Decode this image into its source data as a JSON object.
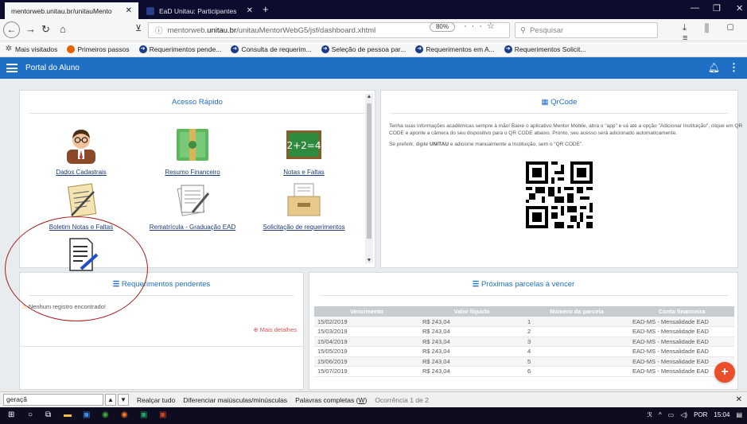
{
  "browser": {
    "tabs": [
      {
        "label": "mentorweb.unitau.br/unitauMento",
        "active": true
      },
      {
        "label": "EaD Unitau: Participantes",
        "active": false
      }
    ],
    "url_prefix": "mentorweb.",
    "url_domain": "unitau.br",
    "url_path": "/unitauMentorWebG5/jsf/dashboard.xhtml",
    "zoom": "80%",
    "search_placeholder": "Pesquisar",
    "bookmarks": [
      {
        "label": "Mais visitados",
        "icon": "gear-icon"
      },
      {
        "label": "Primeiros passos",
        "icon": "firefox-icon"
      },
      {
        "label": "Requerimentos pende...",
        "icon": "link-icon"
      },
      {
        "label": "Consulta de requerim...",
        "icon": "link-icon"
      },
      {
        "label": "Seleção de pessoa par...",
        "icon": "link-icon"
      },
      {
        "label": "Requerimentos em A...",
        "icon": "link-icon"
      },
      {
        "label": "Requerimentos Solicit...",
        "icon": "link-icon"
      }
    ]
  },
  "app": {
    "title": "Portal do Aluno",
    "accent": "#1f6fc5"
  },
  "acesso_rapido": {
    "title": "Acesso Rápido",
    "tiles": [
      {
        "label": "Dados Cadastrais",
        "icon": "user-avatar-icon"
      },
      {
        "label": "Resumo Financeiro",
        "icon": "money-icon"
      },
      {
        "label": "Notas e Faltas",
        "icon": "chalkboard-icon"
      },
      {
        "label": "Boletim Notas e Faltas",
        "icon": "report-card-icon"
      },
      {
        "label": "Rematrícula - Graduação EAD",
        "icon": "document-pen-icon"
      },
      {
        "label": "Solicitação de requerimentos",
        "icon": "file-cabinet-icon"
      },
      {
        "label": "",
        "icon": "edit-document-icon"
      }
    ]
  },
  "qrcode": {
    "title": "QrCode",
    "text1": "Tenha suas informações acadêmicas sempre à mão! Baixe o aplicativo Mentor Mobile, abra o \"app\" e vá até a opção \"Adicionar Instituição\", clique em QR CODE e aponte a câmera do seu dispositivo para o QR CODE abaixo. Pronto, seu acesso será adicionado automaticamente.",
    "text2_prefix": "Se preferir, digite ",
    "text2_strong": "UNITAU",
    "text2_suffix": " e adicione manualmente a Instituição, sem o \"QR CODE\"."
  },
  "requerimentos": {
    "title": "Requerimentos pendentes",
    "empty": "Nenhum registro encontrado!",
    "more": "Mais detalhes"
  },
  "parcelas": {
    "title": "Próximas parcelas à vencer",
    "columns": [
      "Vencimento",
      "Valor líquido",
      "Número da parcela",
      "Conta financeira"
    ],
    "rows": [
      [
        "15/02/2019",
        "R$ 243,04",
        "1",
        "EAD-MS - Mensalidade EAD"
      ],
      [
        "15/03/2019",
        "R$ 243,04",
        "2",
        "EAD-MS - Mensalidade EAD"
      ],
      [
        "15/04/2019",
        "R$ 243,04",
        "3",
        "EAD-MS - Mensalidade EAD"
      ],
      [
        "15/05/2019",
        "R$ 243,04",
        "4",
        "EAD-MS - Mensalidade EAD"
      ],
      [
        "15/06/2019",
        "R$ 243,04",
        "5",
        "EAD-MS - Mensalidade EAD"
      ],
      [
        "15/07/2019",
        "R$ 243,04",
        "6",
        "EAD-MS - Mensalidade EAD"
      ]
    ]
  },
  "findbar": {
    "query": "geraçã",
    "highlight_all": "Realçar tudo",
    "match_case": "Diferenciar maiúsculas/minúsculas",
    "whole_words": "Palavras completas",
    "whole_words_key": "W",
    "result": "Ocorrência 1 de 2"
  },
  "taskbar": {
    "lang": "POR",
    "time": "15:04"
  }
}
